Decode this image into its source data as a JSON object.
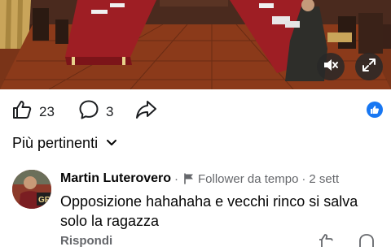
{
  "video": {
    "mute_icon": "speaker-muted-icon",
    "fullscreen_icon": "expand-icon"
  },
  "actions": {
    "like_count": "23",
    "comment_count": "3",
    "like_icon": "thumbs-up-icon",
    "comment_icon": "speech-bubble-icon",
    "share_icon": "share-arrow-icon",
    "reaction_icon": "like-reaction-icon",
    "accent": "#1877f2"
  },
  "sort": {
    "label": "Più pertinenti",
    "icon": "chevron-down-icon"
  },
  "comment": {
    "author": "Martin Luterovero",
    "separator": "·",
    "badge_icon": "flag-icon",
    "badge": "Follower da tempo",
    "time": "2 sett",
    "text": "Opposizione hahahaha e vecchi rinco si salva solo la ragazza",
    "reply_label": "Rispondi"
  }
}
